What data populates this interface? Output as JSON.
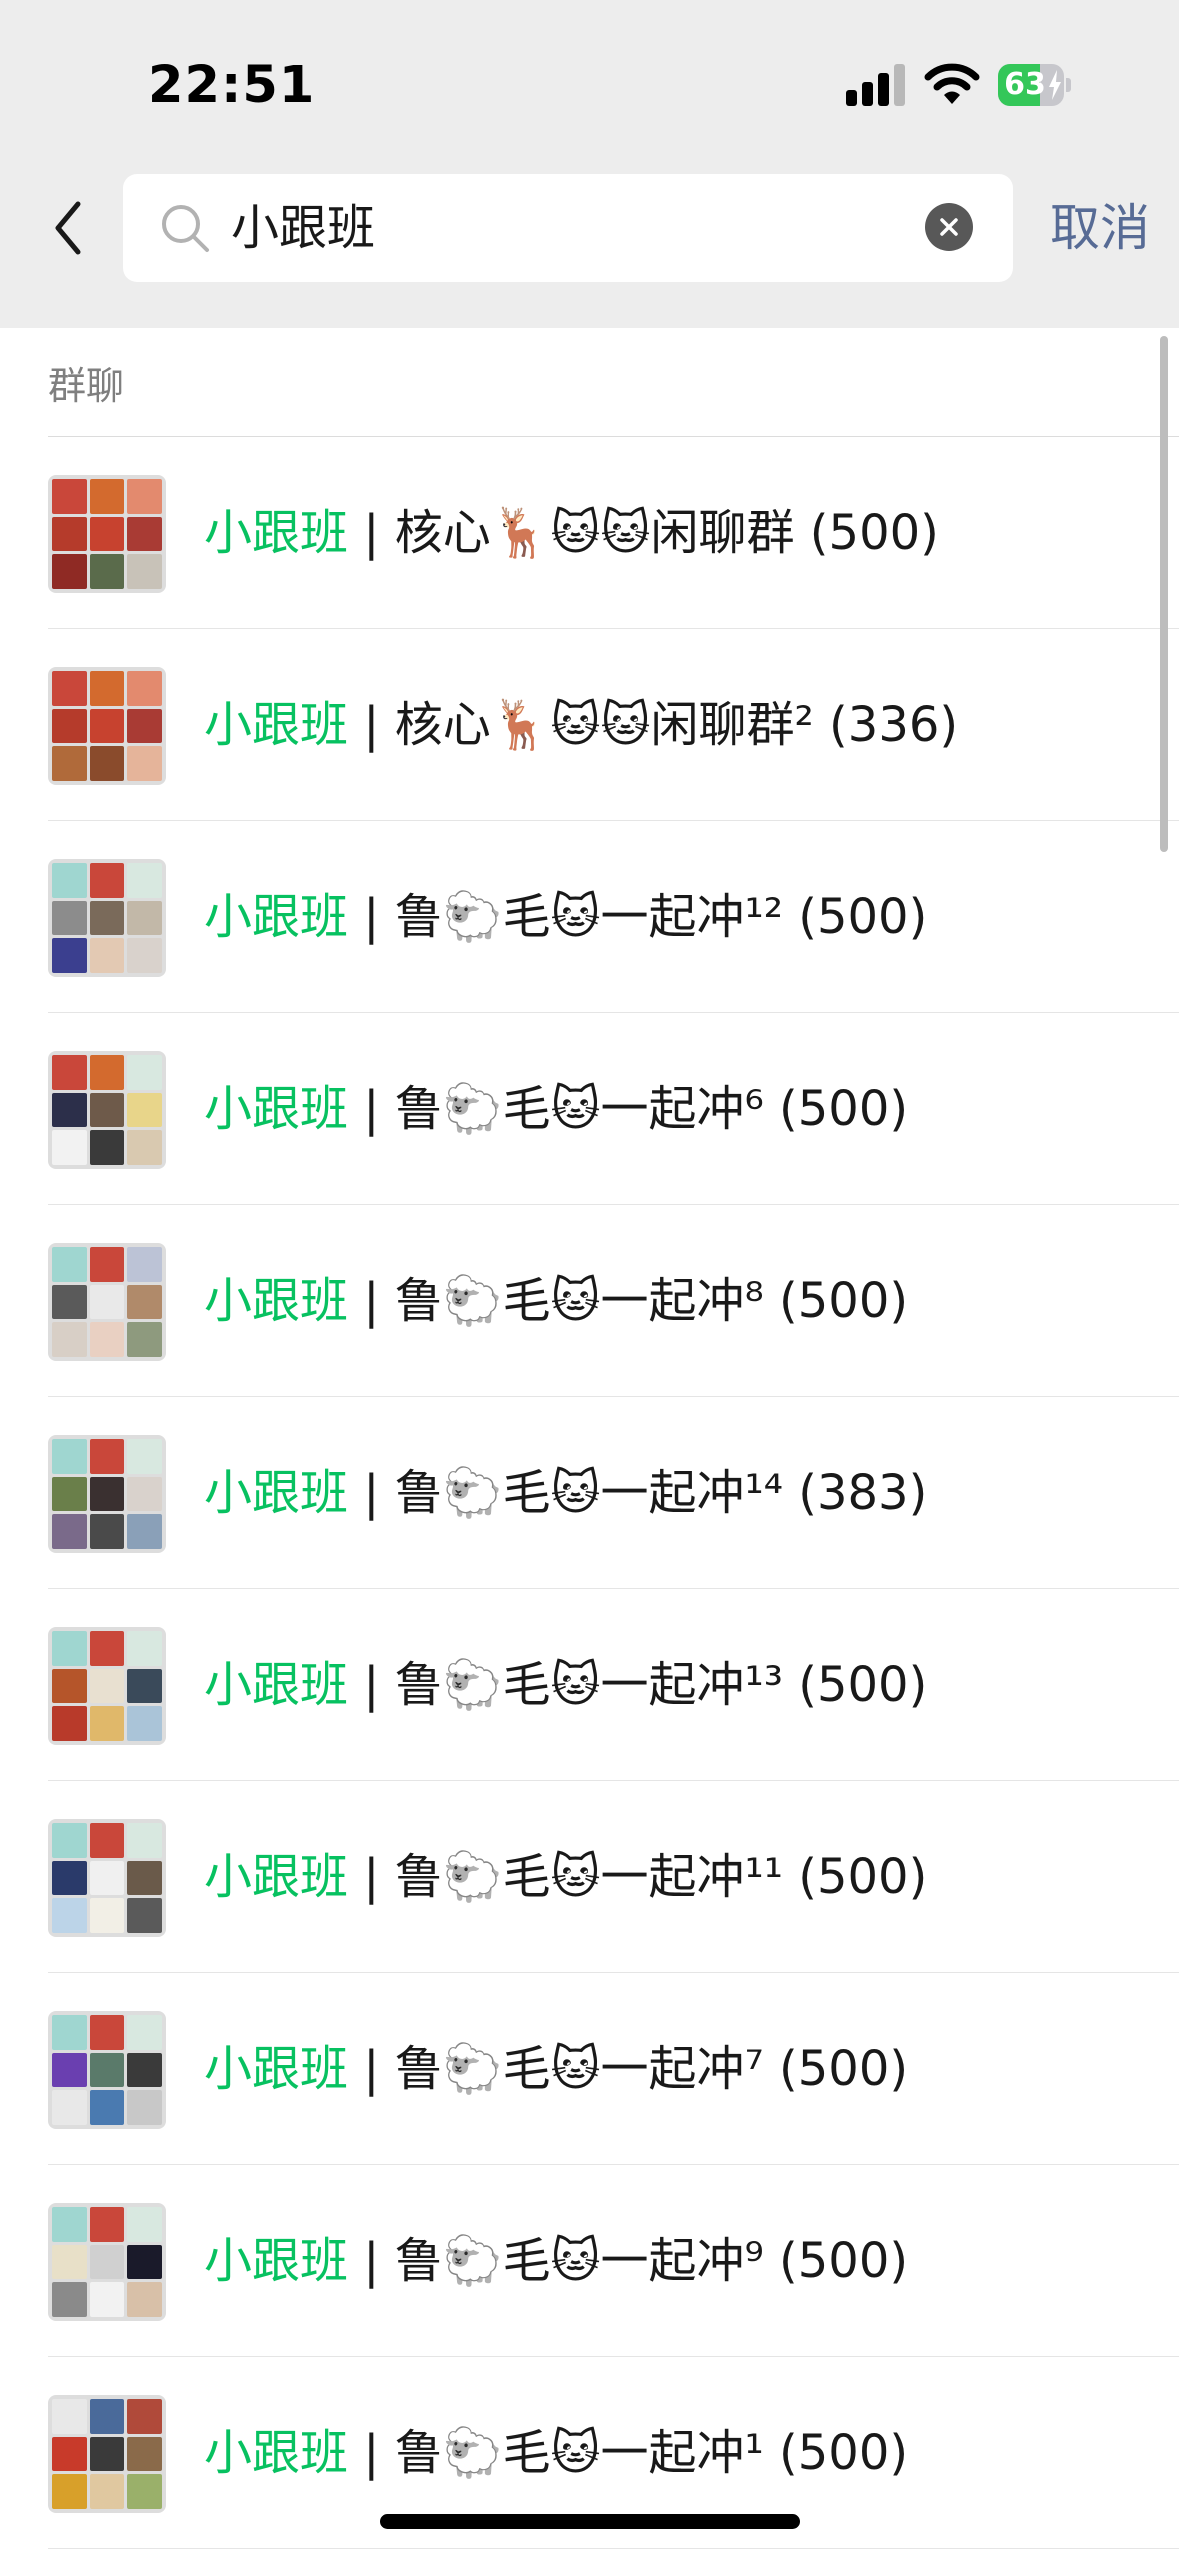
{
  "status_bar": {
    "time": "22:51",
    "battery": "63",
    "battery_level": 0.63
  },
  "search": {
    "value": "小跟班",
    "cancel_label": "取消"
  },
  "section_title": "群聊",
  "results": [
    {
      "highlight": "小跟班",
      "name": " | 核心🦌🐱🐱闲聊群 (500)",
      "avatar": [
        "#c9473a",
        "#d36a2e",
        "#e38a6e",
        "#b53b2b",
        "#c7422f",
        "#a93b34",
        "#8f2a24",
        "#5a6b4b",
        "#c8c2b8"
      ]
    },
    {
      "highlight": "小跟班",
      "name": " | 核心🦌🐱🐱闲聊群² (336)",
      "avatar": [
        "#c9473a",
        "#d36a2e",
        "#e38a6e",
        "#b53b2b",
        "#c7422f",
        "#a93b34",
        "#b06a3a",
        "#8a4b2c",
        "#e5b49a"
      ]
    },
    {
      "highlight": "小跟班",
      "name": " | 鲁🐑毛🐱一起冲¹² (500)",
      "avatar": [
        "#9fd6d0",
        "#c9473a",
        "#d8e8e0",
        "#8c8c8c",
        "#7a6a5a",
        "#c2b8a8",
        "#3b3f8f",
        "#e3c9b3",
        "#d9d2cc"
      ]
    },
    {
      "highlight": "小跟班",
      "name": " | 鲁🐑毛🐱一起冲⁶ (500)",
      "avatar": [
        "#c9473a",
        "#d36a2e",
        "#d8e8e0",
        "#2c2f4a",
        "#6e5a4a",
        "#e8d58a",
        "#f2f2f2",
        "#3a3a3a",
        "#d9c9b0"
      ]
    },
    {
      "highlight": "小跟班",
      "name": " | 鲁🐑毛🐱一起冲⁸ (500)",
      "avatar": [
        "#9fd6d0",
        "#c9473a",
        "#bcc3d6",
        "#5a5a5a",
        "#e9e9e9",
        "#b08a6a",
        "#d8cfc6",
        "#e9d0c2",
        "#8e9a7e"
      ]
    },
    {
      "highlight": "小跟班",
      "name": " | 鲁🐑毛🐱一起冲¹⁴ (383)",
      "avatar": [
        "#9fd6d0",
        "#c9473a",
        "#d8e8e0",
        "#6a7f4a",
        "#3a3030",
        "#d9d2cc",
        "#7a6a8a",
        "#4a4a4a",
        "#8aa0b8"
      ]
    },
    {
      "highlight": "小跟班",
      "name": " | 鲁🐑毛🐱一起冲¹³ (500)",
      "avatar": [
        "#9fd6d0",
        "#c9473a",
        "#d8e8e0",
        "#b5552a",
        "#e8e0d0",
        "#3a4a5a",
        "#b83a2a",
        "#e0b86a",
        "#aac4d8"
      ]
    },
    {
      "highlight": "小跟班",
      "name": " | 鲁🐑毛🐱一起冲¹¹ (500)",
      "avatar": [
        "#9fd6d0",
        "#c9473a",
        "#d8e8e0",
        "#2a3a6a",
        "#f0f0f0",
        "#6a5a4a",
        "#bcd4e8",
        "#f2efe6",
        "#5a5a5a"
      ]
    },
    {
      "highlight": "小跟班",
      "name": " | 鲁🐑毛🐱一起冲⁷ (500)",
      "avatar": [
        "#9fd6d0",
        "#c9473a",
        "#d8e8e0",
        "#6a3fb0",
        "#5a7a6a",
        "#3a3a3a",
        "#e8e8e8",
        "#4a7ab0",
        "#c8c8c8"
      ]
    },
    {
      "highlight": "小跟班",
      "name": " | 鲁🐑毛🐱一起冲⁹ (500)",
      "avatar": [
        "#9fd6d0",
        "#c9473a",
        "#d8e8e0",
        "#e8e0c8",
        "#d0d0d0",
        "#1a1a2a",
        "#8a8a8a",
        "#f2f2f2",
        "#d8c0a8"
      ]
    },
    {
      "highlight": "小跟班",
      "name": " | 鲁🐑毛🐱一起冲¹ (500)",
      "avatar": [
        "#e8e8e8",
        "#4a6a9a",
        "#b04a3a",
        "#c83a2a",
        "#3a3a3a",
        "#8a6a4a",
        "#d8a02a",
        "#e0c8a0",
        "#9ab06a"
      ]
    }
  ]
}
